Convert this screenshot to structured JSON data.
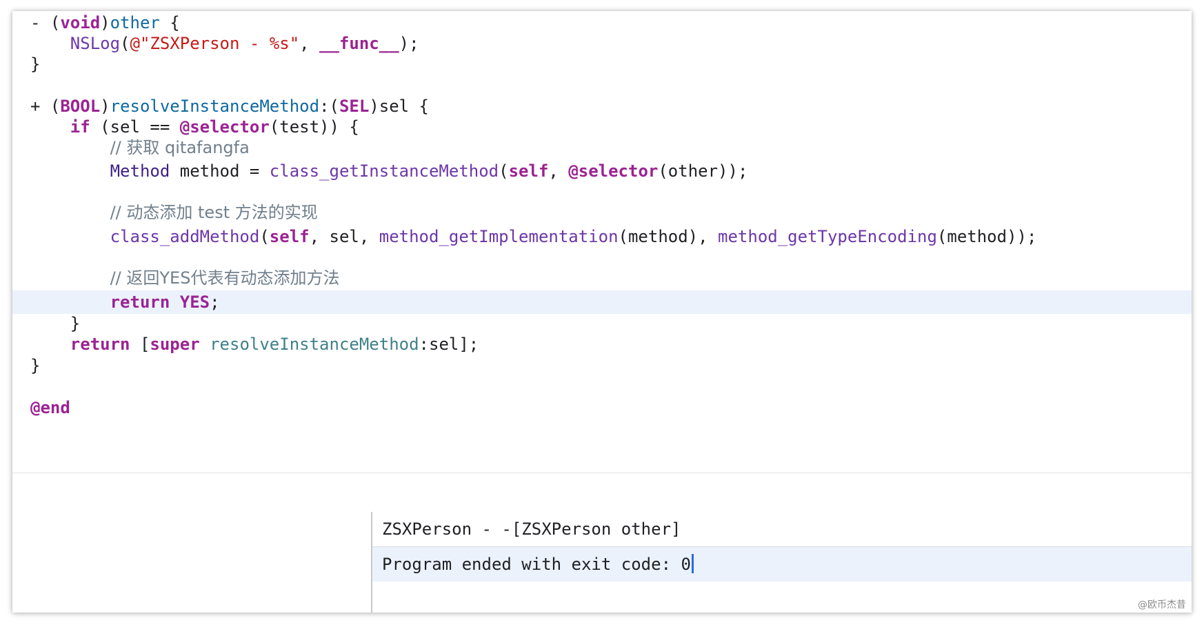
{
  "editor": {
    "lines": [
      {
        "segments": [
          {
            "t": "- (",
            "c": "plain"
          },
          {
            "t": "void",
            "c": "kw"
          },
          {
            "t": ")",
            "c": "plain"
          },
          {
            "t": "other",
            "c": "fnd"
          },
          {
            "t": " {",
            "c": "plain"
          }
        ]
      },
      {
        "segments": [
          {
            "t": "    ",
            "c": "plain"
          },
          {
            "t": "NSLog",
            "c": "sys"
          },
          {
            "t": "(",
            "c": "plain"
          },
          {
            "t": "@\"ZSXPerson - %s\"",
            "c": "str"
          },
          {
            "t": ", ",
            "c": "plain"
          },
          {
            "t": "__func__",
            "c": "kw"
          },
          {
            "t": ");",
            "c": "plain"
          }
        ]
      },
      {
        "segments": [
          {
            "t": "}",
            "c": "plain"
          }
        ]
      },
      {
        "segments": []
      },
      {
        "segments": [
          {
            "t": "+ (",
            "c": "plain"
          },
          {
            "t": "BOOL",
            "c": "kw"
          },
          {
            "t": ")",
            "c": "plain"
          },
          {
            "t": "resolveInstanceMethod",
            "c": "fnd"
          },
          {
            "t": ":(",
            "c": "plain"
          },
          {
            "t": "SEL",
            "c": "kw"
          },
          {
            "t": ")sel {",
            "c": "plain"
          }
        ]
      },
      {
        "segments": [
          {
            "t": "    ",
            "c": "plain"
          },
          {
            "t": "if",
            "c": "kw"
          },
          {
            "t": " (sel == ",
            "c": "plain"
          },
          {
            "t": "@selector",
            "c": "kw"
          },
          {
            "t": "(test)) {",
            "c": "plain"
          }
        ]
      },
      {
        "segments": [
          {
            "t": "        ",
            "c": "plain"
          },
          {
            "t": "// 获取 qitafangfa",
            "c": "cmt"
          }
        ]
      },
      {
        "segments": [
          {
            "t": "        ",
            "c": "plain"
          },
          {
            "t": "Method",
            "c": "ty-plain"
          },
          {
            "t": " method = ",
            "c": "plain"
          },
          {
            "t": "class_getInstanceMethod",
            "c": "sys"
          },
          {
            "t": "(",
            "c": "plain"
          },
          {
            "t": "self",
            "c": "kw"
          },
          {
            "t": ", ",
            "c": "plain"
          },
          {
            "t": "@selector",
            "c": "kw"
          },
          {
            "t": "(other));",
            "c": "plain"
          }
        ]
      },
      {
        "segments": []
      },
      {
        "segments": [
          {
            "t": "        ",
            "c": "plain"
          },
          {
            "t": "// 动态添加 test 方法的实现",
            "c": "cmt"
          }
        ]
      },
      {
        "segments": [
          {
            "t": "        ",
            "c": "plain"
          },
          {
            "t": "class_addMethod",
            "c": "sys"
          },
          {
            "t": "(",
            "c": "plain"
          },
          {
            "t": "self",
            "c": "kw"
          },
          {
            "t": ", sel, ",
            "c": "plain"
          },
          {
            "t": "method_getImplementation",
            "c": "sys"
          },
          {
            "t": "(method), ",
            "c": "plain"
          },
          {
            "t": "method_getTypeEncoding",
            "c": "sys"
          },
          {
            "t": "(method));",
            "c": "plain"
          }
        ]
      },
      {
        "segments": []
      },
      {
        "segments": [
          {
            "t": "        ",
            "c": "plain"
          },
          {
            "t": "// 返回YES代表有动态添加方法",
            "c": "cmt"
          }
        ]
      },
      {
        "segments": [
          {
            "t": "        ",
            "c": "plain"
          },
          {
            "t": "return",
            "c": "kw"
          },
          {
            "t": " ",
            "c": "plain"
          },
          {
            "t": "YES",
            "c": "kw"
          },
          {
            "t": ";",
            "c": "plain"
          }
        ],
        "current": true
      },
      {
        "segments": [
          {
            "t": "    }",
            "c": "plain"
          }
        ]
      },
      {
        "segments": [
          {
            "t": "    ",
            "c": "plain"
          },
          {
            "t": "return",
            "c": "kw"
          },
          {
            "t": " [",
            "c": "plain"
          },
          {
            "t": "super",
            "c": "kw"
          },
          {
            "t": " ",
            "c": "plain"
          },
          {
            "t": "resolveInstanceMethod",
            "c": "cls"
          },
          {
            "t": ":sel];",
            "c": "plain"
          }
        ]
      },
      {
        "segments": [
          {
            "t": "}",
            "c": "plain"
          }
        ]
      },
      {
        "segments": []
      },
      {
        "segments": [
          {
            "t": "@end",
            "c": "kw"
          }
        ]
      }
    ]
  },
  "console": {
    "output_line": "ZSXPerson - -[ZSXPerson other]",
    "exit_line": "Program ended with exit code: 0"
  },
  "watermark": "@欧币杰昔",
  "colors": {
    "keyword": "#9b2393",
    "method_name": "#0f68a0",
    "system_function": "#6c36a9",
    "string": "#c41a16",
    "comment": "#707f8c",
    "current_line_highlight": "#ebf2fc",
    "caret": "#2a6ae0"
  }
}
